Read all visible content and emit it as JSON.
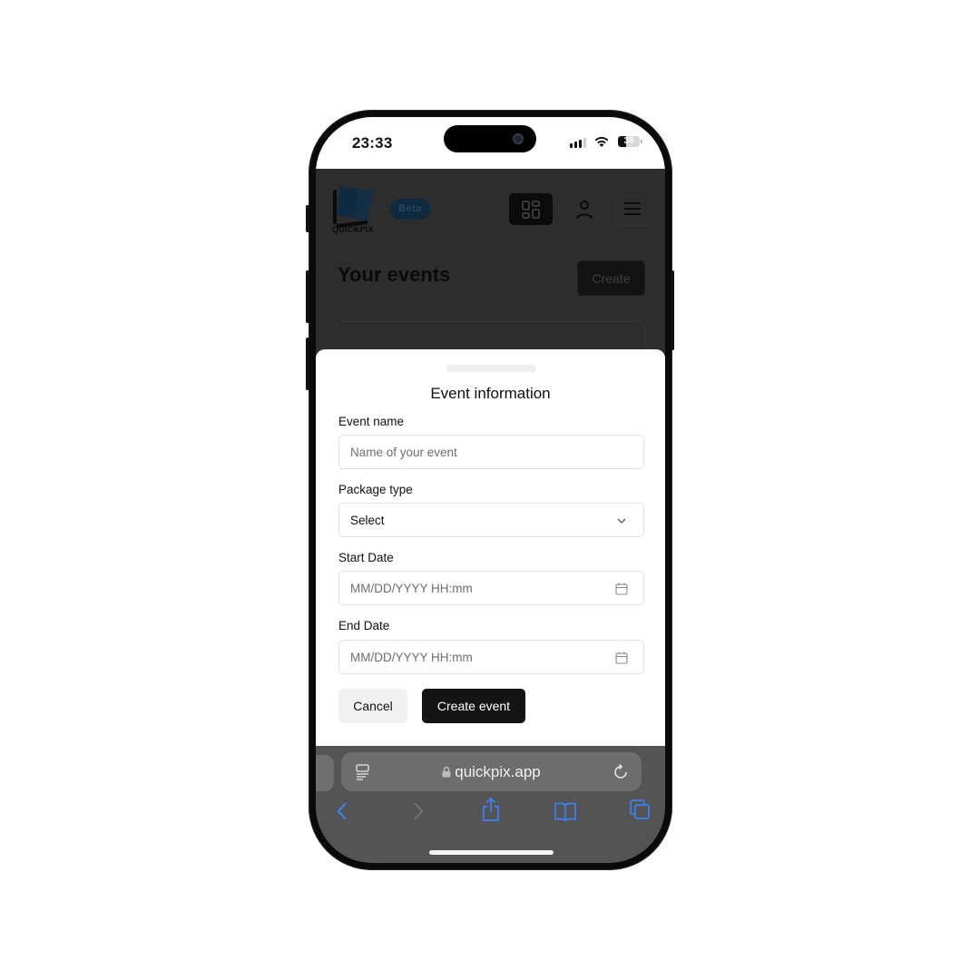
{
  "status_bar": {
    "time": "23:33",
    "battery_percent": "38",
    "battery_level": 0.38
  },
  "header": {
    "logo_text": "QUICKPIX",
    "badge": "Beta",
    "icons": [
      "dashboard-grid-icon",
      "user-icon",
      "hamburger-menu-icon"
    ]
  },
  "page": {
    "title": "Your events",
    "create_label": "Create"
  },
  "sheet": {
    "title": "Event information",
    "fields": [
      {
        "label": "Event name",
        "placeholder": "Name of your event",
        "type": "text"
      },
      {
        "label": "Package type",
        "value": "Select",
        "type": "select"
      },
      {
        "label": "Start Date",
        "placeholder": "MM/DD/YYYY HH:mm",
        "type": "datetime"
      },
      {
        "label": "End Date",
        "placeholder": "MM/DD/YYYY HH:mm",
        "type": "datetime"
      }
    ],
    "cancel_label": "Cancel",
    "submit_label": "Create event"
  },
  "browser": {
    "url": "quickpix.app",
    "accent_color": "#3b82f6",
    "toolbar_icons": [
      "back-icon",
      "forward-icon",
      "share-icon",
      "bookmarks-icon",
      "tabs-icon"
    ]
  }
}
